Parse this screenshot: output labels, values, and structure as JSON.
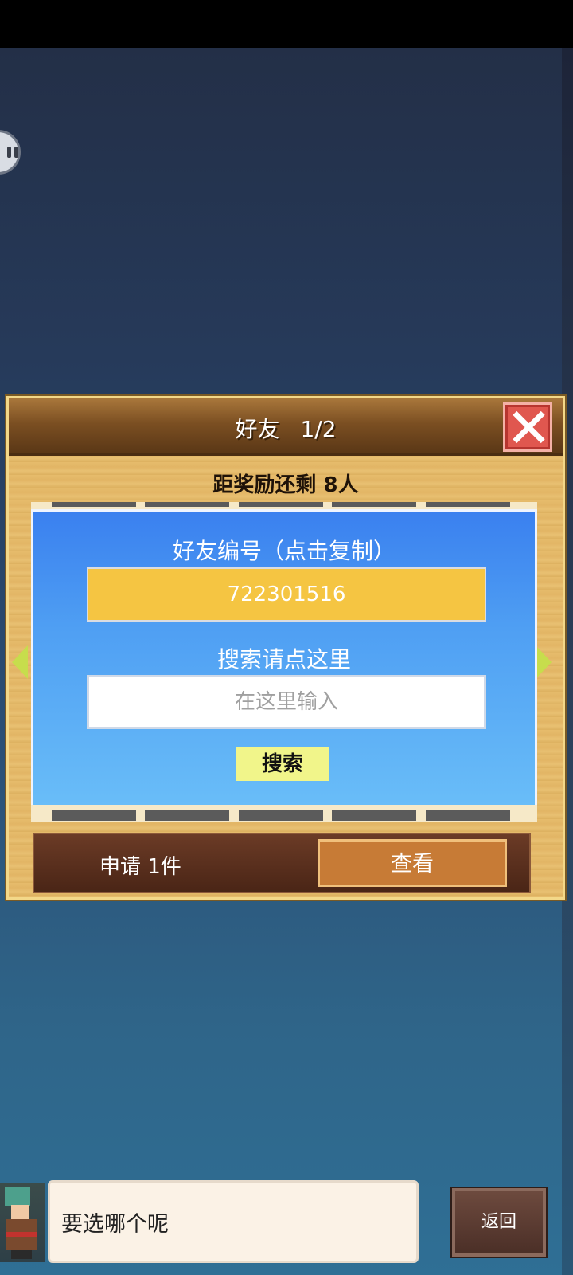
{
  "dialog": {
    "title": "好友",
    "page": "1/2",
    "reward_text": "距奖励还剩 8人"
  },
  "friend_panel": {
    "id_label": "好友编号（点击复制）",
    "friend_id": "722301516",
    "search_label": "搜索请点这里",
    "search_placeholder": "在这里输入",
    "search_value": "",
    "search_button": "搜索"
  },
  "requests": {
    "text": "申请 1件",
    "view_button": "查看"
  },
  "bottom": {
    "speech": "要选哪个呢",
    "back_button": "返回"
  },
  "colors": {
    "accent_yellow": "#f5c542",
    "panel_blue": "#4f9ff3",
    "close_red": "#e0574f",
    "view_orange": "#c77b36"
  },
  "icons": {
    "close": "close-icon",
    "prev": "arrow-left-icon",
    "next": "arrow-right-icon",
    "chat": "chat-bubble-icon"
  }
}
